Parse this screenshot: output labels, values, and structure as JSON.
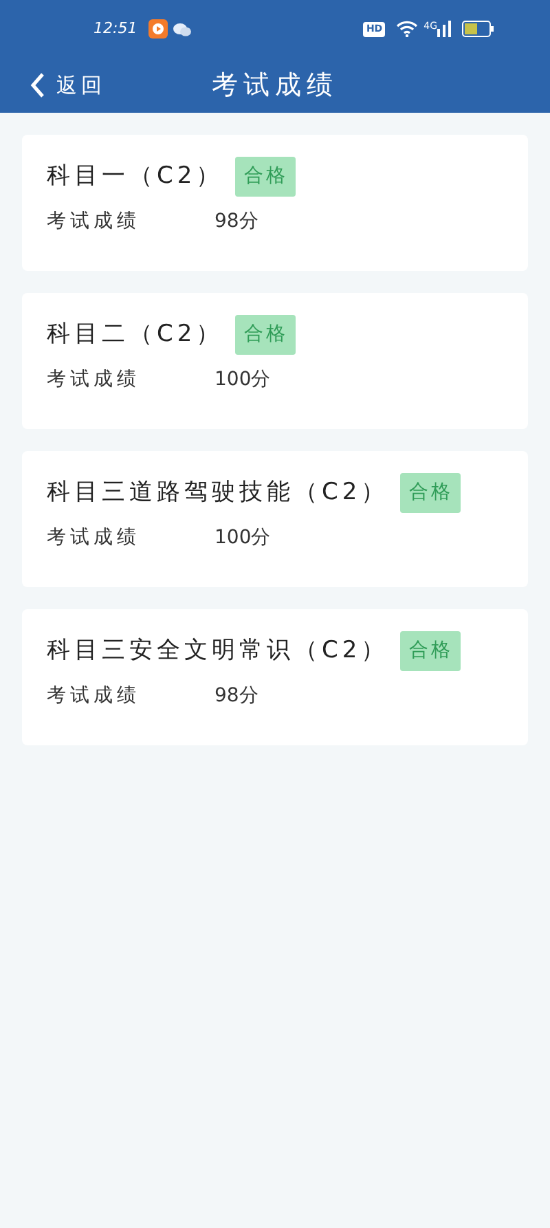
{
  "status_bar": {
    "time": "12:51",
    "hd": "HD",
    "network": "4G"
  },
  "header": {
    "back": "返回",
    "title": "考试成绩"
  },
  "results": [
    {
      "subject": "科目一（C2）",
      "status": "合格",
      "label": "考试成绩",
      "score": "98分"
    },
    {
      "subject": "科目二（C2）",
      "status": "合格",
      "label": "考试成绩",
      "score": "100分"
    },
    {
      "subject": "科目三道路驾驶技能（C2）",
      "status": "合格",
      "label": "考试成绩",
      "score": "100分"
    },
    {
      "subject": "科目三安全文明常识（C2）",
      "status": "合格",
      "label": "考试成绩",
      "score": "98分"
    }
  ]
}
